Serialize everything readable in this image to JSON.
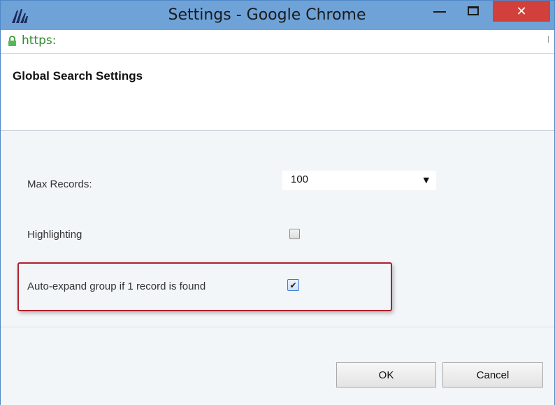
{
  "window": {
    "title": "Settings - Google Chrome",
    "close_symbol": "✕"
  },
  "address_bar": {
    "url": "https:"
  },
  "dialog": {
    "title": "Global Search Settings",
    "fields": {
      "max_records_label": "Max Records:",
      "max_records_value": "100",
      "highlighting_label": "Highlighting",
      "highlighting_checked": false,
      "auto_expand_label": "Auto-expand group if 1 record is found",
      "auto_expand_checked": true
    },
    "buttons": {
      "ok_label": "OK",
      "cancel_label": "Cancel"
    }
  },
  "icons": {
    "app_logo": "dynamics-logo-icon",
    "lock": "lock-icon",
    "dropdown": "triangle-down-icon",
    "check": "checkmark-icon"
  },
  "colors": {
    "titlebar": "#6fa3d8",
    "close_button": "#d1403a",
    "url_secure": "#2e8b2e",
    "highlight_border": "#b0202a"
  }
}
